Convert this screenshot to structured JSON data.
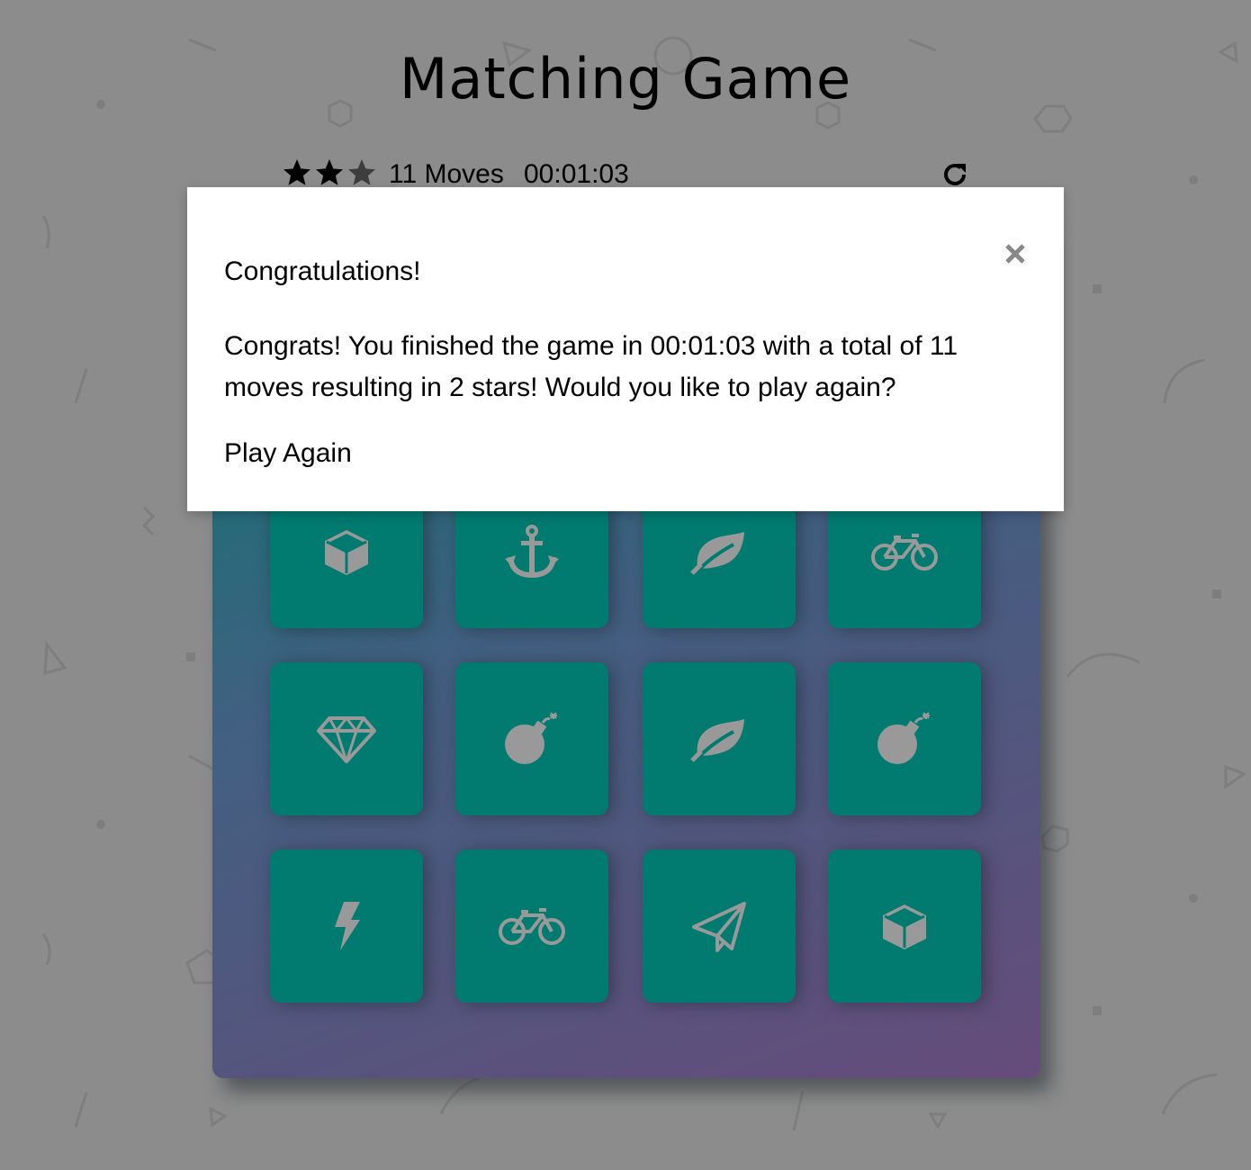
{
  "title": "Matching Game",
  "score_panel": {
    "stars_total": 3,
    "stars_earned": 2,
    "moves_label": "11 Moves",
    "timer": "00:01:03",
    "restart_icon": "restart-icon"
  },
  "deck": {
    "cards": [
      {
        "icon": "cube",
        "state": "match"
      },
      {
        "icon": "anchor",
        "state": "match"
      },
      {
        "icon": "leaf",
        "state": "match"
      },
      {
        "icon": "bicycle",
        "state": "match"
      },
      {
        "icon": "diamond",
        "state": "match"
      },
      {
        "icon": "bomb",
        "state": "match"
      },
      {
        "icon": "leaf",
        "state": "match"
      },
      {
        "icon": "bomb",
        "state": "match"
      },
      {
        "icon": "bolt",
        "state": "match"
      },
      {
        "icon": "bicycle",
        "state": "match"
      },
      {
        "icon": "paper-plane",
        "state": "match"
      },
      {
        "icon": "cube",
        "state": "match"
      }
    ]
  },
  "modal": {
    "heading": "Congratulations!",
    "body": "Congrats! You finished the game in 00:01:03 with a total of 11 moves resulting in 2 stars! Would you like to play again?",
    "button_label": "Play Again",
    "close_icon": "close-icon"
  },
  "colors": {
    "card_match": "#02ccba",
    "icon_color": "#ffffff",
    "star_filled": "#000000",
    "star_empty": "#666666"
  }
}
